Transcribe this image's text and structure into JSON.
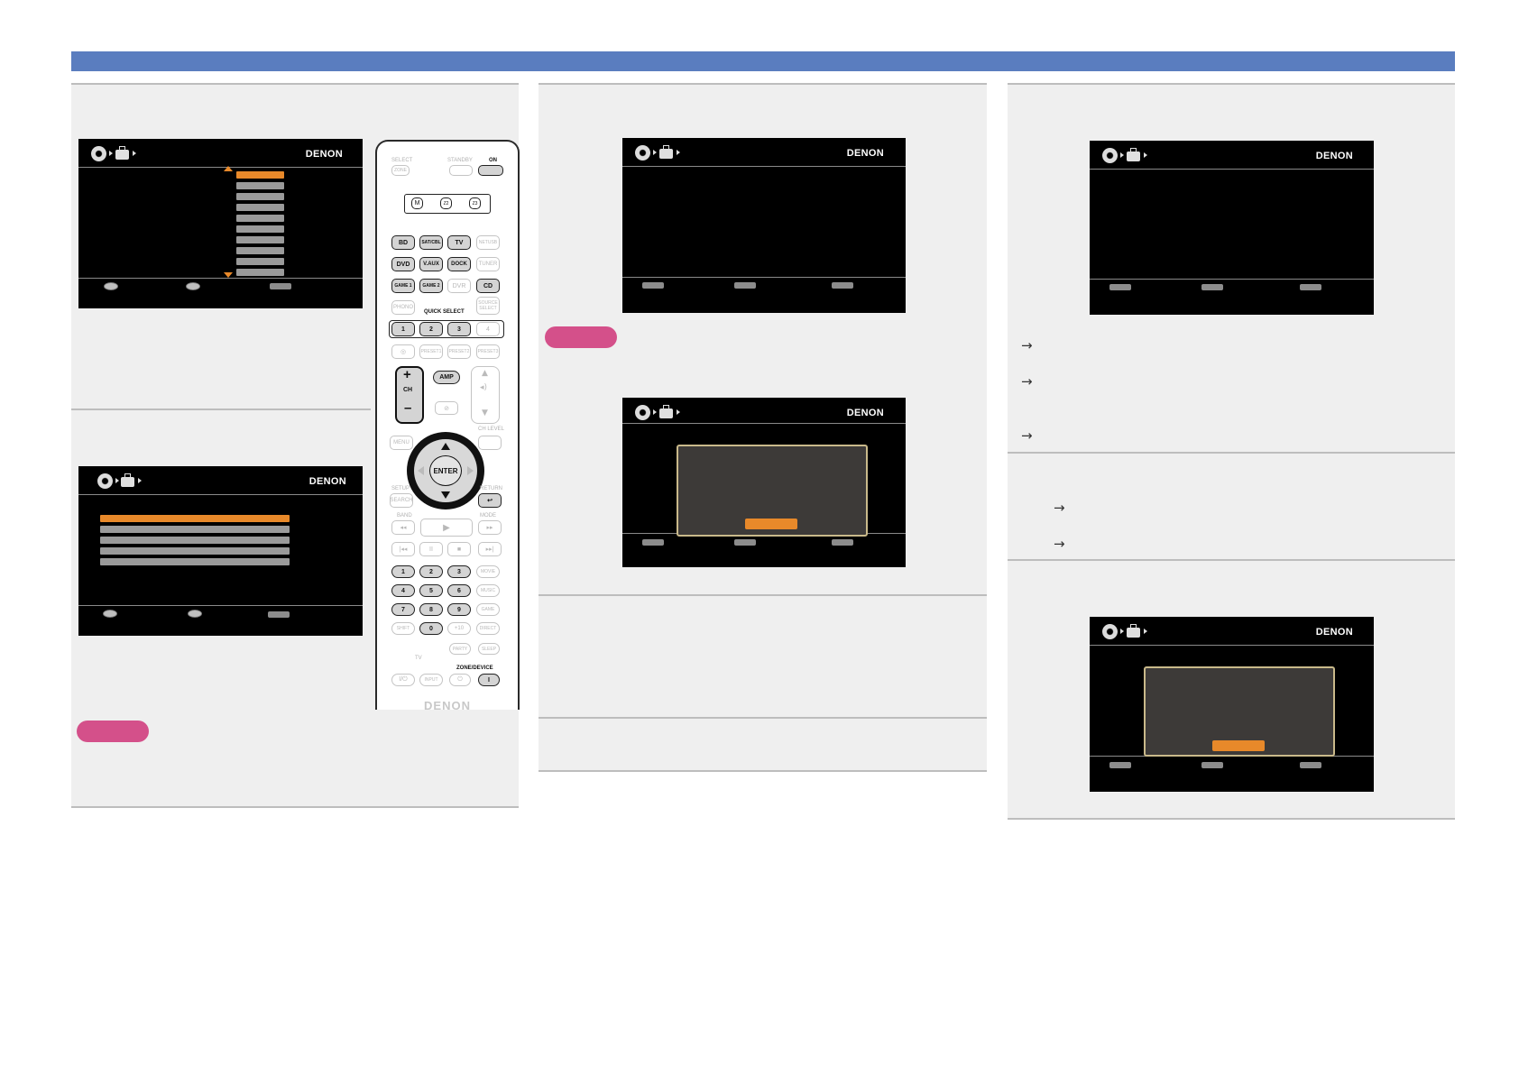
{
  "osd": {
    "brand": "DENON"
  },
  "remote": {
    "top_labels": {
      "select": "SELECT",
      "standby": "STANDBY",
      "on": "ON",
      "zone": "ZONE"
    },
    "zone_buttons": [
      "M",
      "Z2",
      "Z3"
    ],
    "source_rows": [
      [
        {
          "label": "BD",
          "on": true
        },
        {
          "label": "SAT/CBL",
          "on": true
        },
        {
          "label": "TV",
          "on": true
        },
        {
          "label": "NETUSB",
          "on": false
        }
      ],
      [
        {
          "label": "DVD",
          "on": true
        },
        {
          "label": "V.AUX",
          "on": true
        },
        {
          "label": "DOCK",
          "on": true
        },
        {
          "label": "TUNER",
          "on": false
        }
      ],
      [
        {
          "label": "GAME 1",
          "on": true
        },
        {
          "label": "GAME 2",
          "on": true
        },
        {
          "label": "DVR",
          "on": false
        },
        {
          "label": "CD",
          "on": true
        }
      ]
    ],
    "phono": "PHONO",
    "quick_select": "QUICK SELECT",
    "source_select": "SOURCE SELECT",
    "quick_buttons": [
      "1",
      "2",
      "3",
      "4"
    ],
    "preset_row": [
      "",
      "PRESET1",
      "PRESET2",
      "PRESET3"
    ],
    "ch_plus": "+",
    "ch_label": "CH",
    "ch_minus": "–",
    "amp": "AMP",
    "menu": "MENU",
    "search": "SEARCH",
    "setup": "SETUP",
    "return_label": "RETURN",
    "ch_level": "CH LEVEL",
    "enter": "ENTER",
    "band": "BAND",
    "mode": "MODE",
    "number_rows": [
      [
        {
          "label": "1",
          "on": true
        },
        {
          "label": "2",
          "on": true
        },
        {
          "label": "3",
          "on": true
        },
        {
          "label": "MOVIE",
          "on": false
        }
      ],
      [
        {
          "label": "4",
          "on": true
        },
        {
          "label": "5",
          "on": true
        },
        {
          "label": "6",
          "on": true
        },
        {
          "label": "MUSIC",
          "on": false
        }
      ],
      [
        {
          "label": "7",
          "on": true
        },
        {
          "label": "8",
          "on": true
        },
        {
          "label": "9",
          "on": true
        },
        {
          "label": "GAME",
          "on": false
        }
      ],
      [
        {
          "label": "SHIFT",
          "on": false
        },
        {
          "label": "0",
          "on": true
        },
        {
          "label": "+10",
          "on": false
        },
        {
          "label": "DIRECT",
          "on": false
        }
      ]
    ],
    "party": "PARTY",
    "sleep": "SLEEP",
    "zone_device": "ZONE/DEVICE",
    "tv": "TV",
    "input": "INPUT",
    "brand": "DENON"
  }
}
